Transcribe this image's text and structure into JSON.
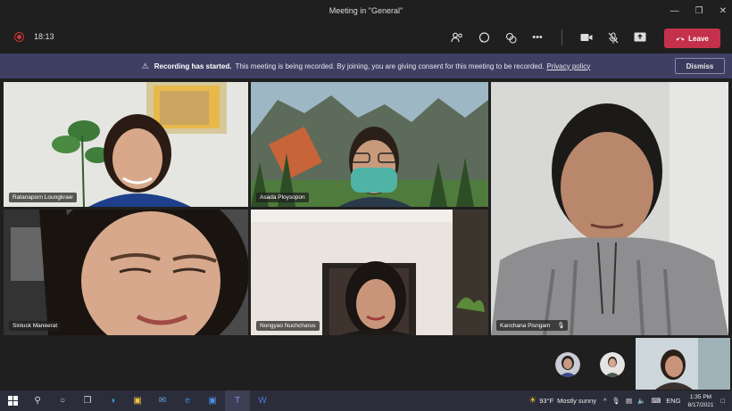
{
  "window": {
    "title": "Meeting in \"General\""
  },
  "toolbar": {
    "timer": "18:13",
    "leave_label": "Leave"
  },
  "banner": {
    "title": "Recording has started.",
    "message": "This meeting is being recorded. By joining, you are giving consent for this meeting to be recorded.",
    "link": "Privacy policy",
    "dismiss_label": "Dismiss"
  },
  "participants": [
    {
      "name": "Ratanaporn Loungkraw"
    },
    {
      "name": "Asada Ploysopon"
    },
    {
      "name": "Kanchana Pisngam"
    },
    {
      "name": "Sinluck Maneerat"
    },
    {
      "name": "Nongyao Nuchcharus"
    }
  ],
  "taskbar": {
    "weather_temp": "93°F",
    "weather_text": "Mostly sunny",
    "language": "ENG",
    "time": "1:35 PM",
    "date": "8/17/2021"
  },
  "colors": {
    "leave": "#c4314b",
    "banner": "#3f3f64",
    "taskbar": "#2b2d3a"
  }
}
